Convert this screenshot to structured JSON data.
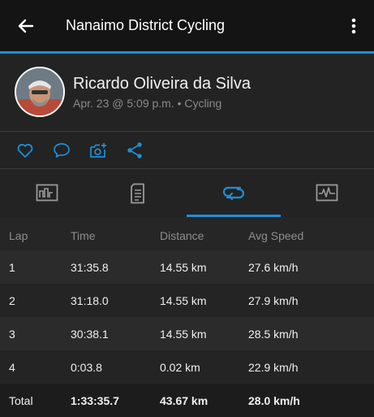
{
  "appbar": {
    "title": "Nanaimo District Cycling",
    "back_icon": "arrow-left-icon",
    "menu_icon": "more-vertical-icon"
  },
  "profile": {
    "name": "Ricardo Oliveira da Silva",
    "meta": "Apr. 23 @ 5:09 p.m. • Cycling"
  },
  "actions": {
    "icons": [
      "heart-icon",
      "comment-icon",
      "add-photo-icon",
      "share-icon"
    ]
  },
  "tabs": {
    "icons": [
      "stats-icon",
      "details-icon",
      "laps-icon",
      "chart-icon"
    ],
    "active_index": 2
  },
  "laps": {
    "headers": [
      "Lap",
      "Time",
      "Distance",
      "Avg Speed"
    ],
    "rows": [
      [
        "1",
        "31:35.8",
        "14.55 km",
        "27.6 km/h"
      ],
      [
        "2",
        "31:18.0",
        "14.55 km",
        "27.9 km/h"
      ],
      [
        "3",
        "30:38.1",
        "14.55 km",
        "28.5 km/h"
      ],
      [
        "4",
        "0:03.8",
        "0.02 km",
        "22.9 km/h"
      ]
    ],
    "total": [
      "Total",
      "1:33:35.7",
      "43.67 km",
      "28.0 km/h"
    ]
  },
  "colors": {
    "accent": "#1e8fd8",
    "background": "#1f1f1f"
  }
}
